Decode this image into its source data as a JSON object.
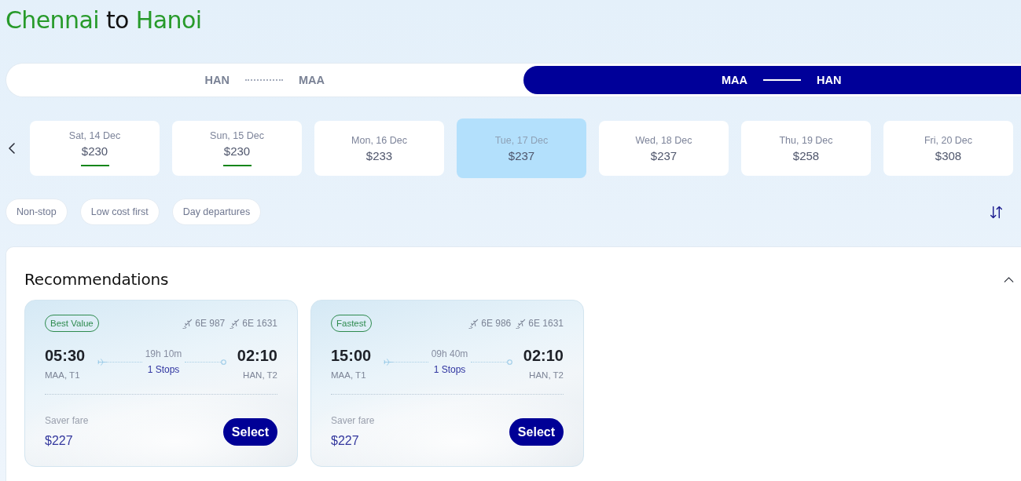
{
  "title": {
    "parts": [
      {
        "text": "Chennai",
        "highlight": true
      },
      {
        "text": "to",
        "highlight": false
      },
      {
        "text": "Hanoi",
        "highlight": true
      }
    ]
  },
  "route_tabs": [
    {
      "from": "HAN",
      "to": "MAA",
      "selected": false
    },
    {
      "from": "MAA",
      "to": "HAN",
      "selected": true
    }
  ],
  "date_strip": {
    "dates": [
      {
        "date": "Sat, 14 Dec",
        "price": "$230",
        "selected": false,
        "cheapest": true
      },
      {
        "date": "Sun, 15 Dec",
        "price": "$230",
        "selected": false,
        "cheapest": true
      },
      {
        "date": "Mon, 16 Dec",
        "price": "$233",
        "selected": false,
        "cheapest": false
      },
      {
        "date": "Tue, 17 Dec",
        "price": "$237",
        "selected": true,
        "cheapest": false
      },
      {
        "date": "Wed, 18 Dec",
        "price": "$237",
        "selected": false,
        "cheapest": false
      },
      {
        "date": "Thu, 19 Dec",
        "price": "$258",
        "selected": false,
        "cheapest": false
      },
      {
        "date": "Fri, 20 Dec",
        "price": "$308",
        "selected": false,
        "cheapest": false
      }
    ]
  },
  "filters": [
    {
      "label": "Non-stop",
      "selected": false
    },
    {
      "label": "Low cost first",
      "selected": false
    },
    {
      "label": "Day departures",
      "selected": false
    }
  ],
  "recommendations": {
    "title": "Recommendations",
    "expanded": true,
    "cards": [
      {
        "badge": "Best Value",
        "flights": [
          "6E 987",
          "6E 1631"
        ],
        "departure": {
          "time": "05:30",
          "airport": "MAA, T1"
        },
        "duration": "19h 10m",
        "stops": "1 Stops",
        "arrival": {
          "time": "02:10",
          "airport": "HAN, T2"
        },
        "fare_label": "Saver fare",
        "price": "$227",
        "button": "Select"
      },
      {
        "badge": "Fastest",
        "flights": [
          "6E 986",
          "6E 1631"
        ],
        "departure": {
          "time": "15:00",
          "airport": "MAA, T1"
        },
        "duration": "09h 40m",
        "stops": "1 Stops",
        "arrival": {
          "time": "02:10",
          "airport": "HAN, T2"
        },
        "fare_label": "Saver fare",
        "price": "$227",
        "button": "Select"
      }
    ]
  }
}
